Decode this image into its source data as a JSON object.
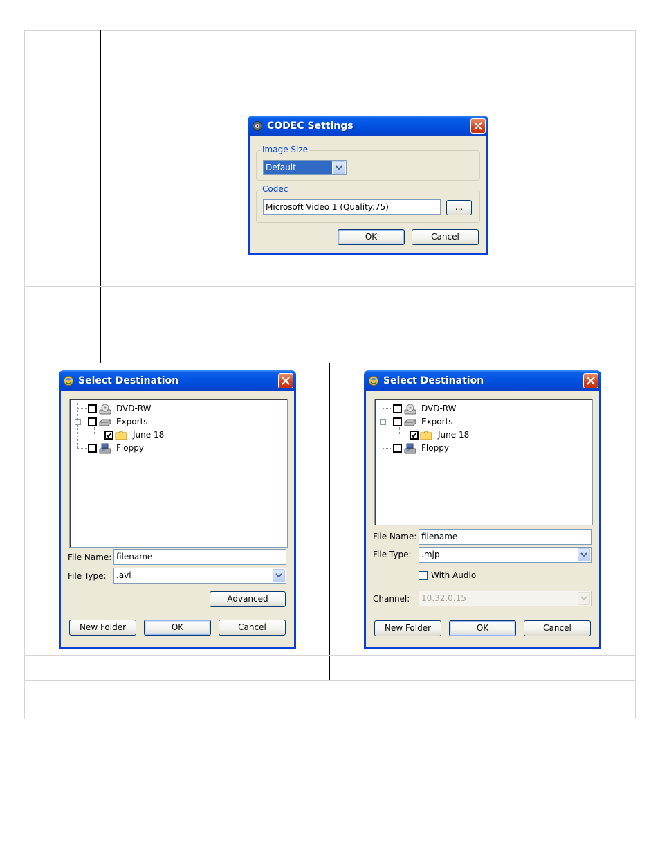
{
  "codec_dialog": {
    "title": "CODEC Settings",
    "image_size_group": "Image Size",
    "image_size_value": "Default",
    "codec_group": "Codec",
    "codec_value": "Microsoft Video 1 (Quality:75)",
    "browse_label": "...",
    "ok_label": "OK",
    "cancel_label": "Cancel"
  },
  "destination_left": {
    "title": "Select Destination",
    "tree": [
      "DVD-RW",
      "Exports",
      "June 18",
      "Floppy"
    ],
    "file_name_label": "File Name:",
    "file_name_value": "filename",
    "file_type_label": "File Type:",
    "file_type_value": ".avi",
    "advanced_label": "Advanced",
    "new_folder_label": "New Folder",
    "ok_label": "OK",
    "cancel_label": "Cancel"
  },
  "destination_right": {
    "title": "Select Destination",
    "tree": [
      "DVD-RW",
      "Exports",
      "June 18",
      "Floppy"
    ],
    "file_name_label": "File Name:",
    "file_name_value": "filename",
    "file_type_label": "File Type:",
    "file_type_value": ".mjp",
    "with_audio_label": "With Audio",
    "channel_label": "Channel:",
    "channel_value": "10.32.0.15",
    "new_folder_label": "New Folder",
    "ok_label": "OK",
    "cancel_label": "Cancel"
  },
  "icons": {
    "app": "app-icon",
    "close": "close-icon",
    "dvd": "dvd-drive-icon",
    "exports": "drive-icon",
    "folder": "folder-icon",
    "floppy": "floppy-drive-icon",
    "dropdown": "chevron-down-icon"
  },
  "colors": {
    "titlebar": "#0053e1",
    "dialog_bg": "#ece9d8",
    "close": "#d5401b",
    "group_label": "#0046d5"
  }
}
